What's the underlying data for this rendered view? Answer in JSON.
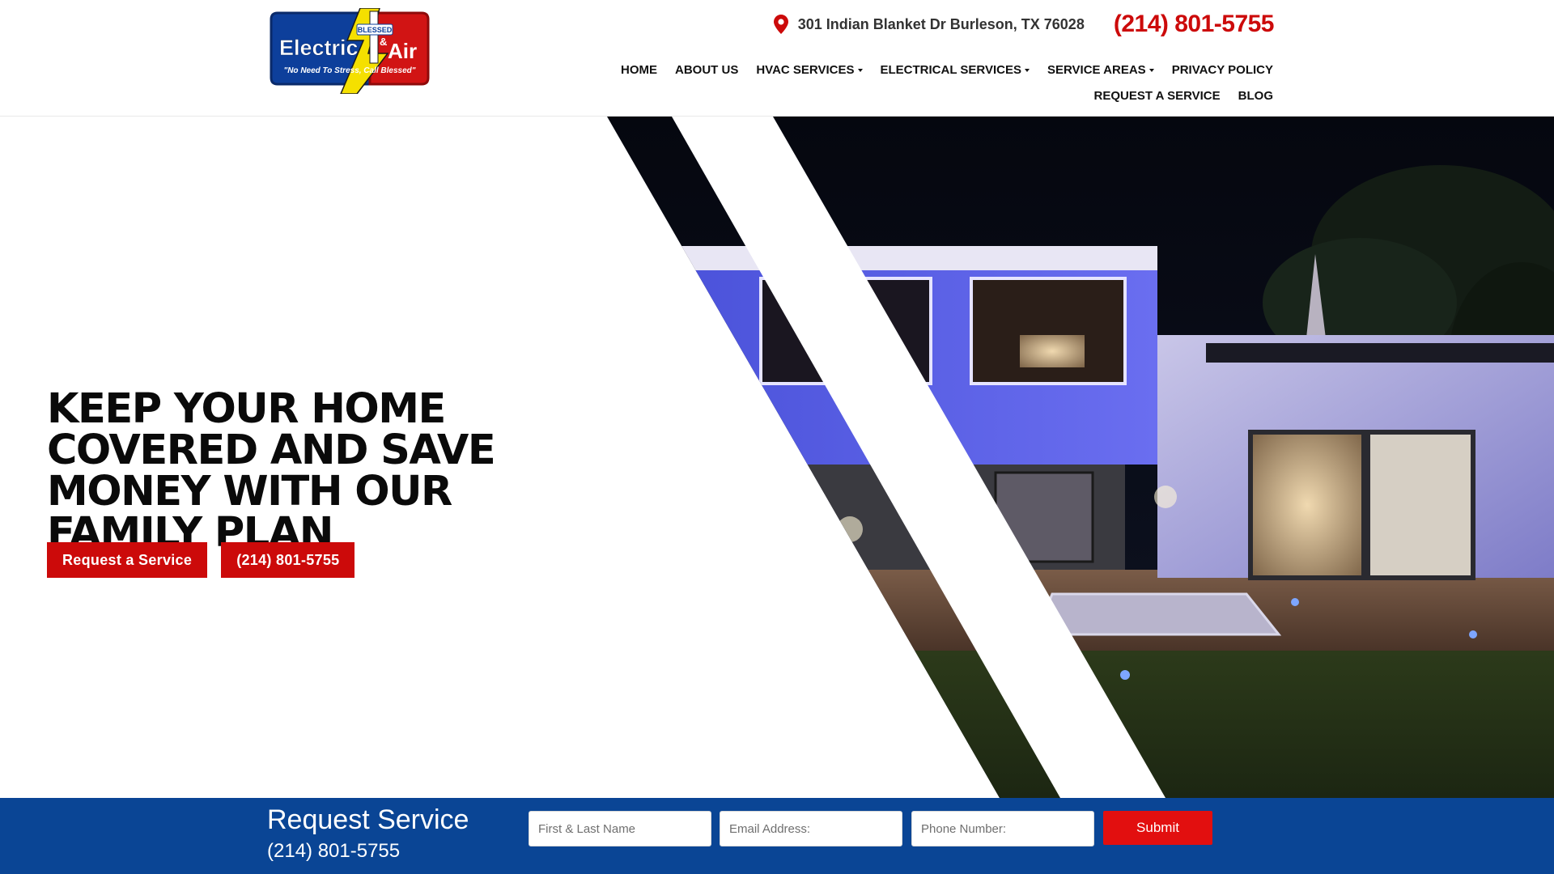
{
  "header": {
    "logo_text": {
      "main_left": "Electric",
      "main_right": "Air",
      "ampersand": "&",
      "top_tag": "BLESSED",
      "slogan": "\"No Need To Stress, Call Blessed\""
    },
    "address": "301 Indian Blanket Dr Burleson, TX 76028",
    "phone": "(214) 801-5755",
    "nav_row1": [
      {
        "label": "HOME",
        "dropdown": false
      },
      {
        "label": "ABOUT US",
        "dropdown": false
      },
      {
        "label": "HVAC SERVICES",
        "dropdown": true
      },
      {
        "label": "ELECTRICAL SERVICES",
        "dropdown": true
      },
      {
        "label": "SERVICE AREAS",
        "dropdown": true
      },
      {
        "label": "PRIVACY POLICY",
        "dropdown": false
      }
    ],
    "nav_row2": [
      {
        "label": "REQUEST A SERVICE",
        "dropdown": false
      },
      {
        "label": "BLOG",
        "dropdown": false
      }
    ]
  },
  "hero": {
    "title": "KEEP YOUR HOME COVERED AND SAVE MONEY WITH OUR FAMILY PLAN",
    "cta_primary": "Request a Service",
    "cta_phone": "(214) 801-5755"
  },
  "request_bar": {
    "title": "Request Service",
    "phone": "(214) 801-5755",
    "name_placeholder": "First & Last Name",
    "email_placeholder": "Email Address:",
    "phone_placeholder": "Phone Number:",
    "submit_label": "Submit"
  },
  "colors": {
    "brand_red": "#cc0a0a",
    "brand_blue": "#0a4595",
    "submit_red": "#e20f0f",
    "logo_yellow": "#f5e000"
  },
  "icons": {
    "address": "map-pin-icon",
    "dropdown": "caret-down-icon"
  }
}
